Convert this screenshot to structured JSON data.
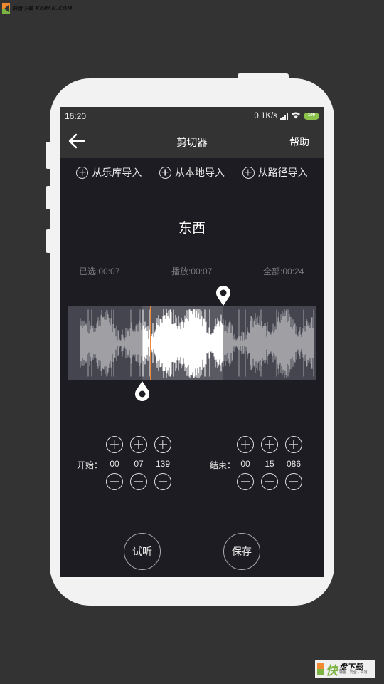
{
  "watermark": {
    "top_text": "快盘下载 KKPAN.COM",
    "bottom_main": "快",
    "bottom_text": "盘下载",
    "bottom_sub": "特色 · 安全 · 高速"
  },
  "status_bar": {
    "time": "16:20",
    "net_speed": "0.1K/s",
    "battery": "100",
    "icons": [
      "signal-icon",
      "wifi-icon",
      "battery-icon"
    ]
  },
  "app_bar": {
    "back_icon": "arrow-left-icon",
    "title": "剪切器",
    "help_label": "帮助"
  },
  "import_options": [
    {
      "icon": "plus-circle-icon",
      "label": "从乐库导入"
    },
    {
      "icon": "plus-circle-icon",
      "label": "从本地导入"
    },
    {
      "icon": "plus-circle-icon",
      "label": "从路径导入"
    }
  ],
  "song": {
    "title": "东西"
  },
  "times": {
    "selected": "已选:00:07",
    "playing": "播放:00:07",
    "total": "全部:00:24"
  },
  "waveform": {
    "total_seconds": 24,
    "selection_start_fraction": 0.3,
    "selection_end_fraction": 0.625,
    "playhead_fraction": 0.33,
    "colors": {
      "wave_unselected": "#a0a0a4",
      "wave_selected": "#ffffff",
      "playhead": "#f08a3a"
    }
  },
  "start": {
    "label": "开始：",
    "values": [
      "00",
      "07",
      "139"
    ]
  },
  "end": {
    "label": "结束：",
    "values": [
      "00",
      "15",
      "086"
    ]
  },
  "actions": {
    "preview_label": "试听",
    "save_label": "保存"
  }
}
